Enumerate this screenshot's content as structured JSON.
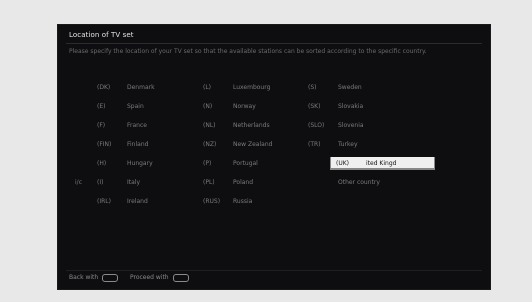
{
  "screen": {
    "title": "Location of TV set",
    "description": "Please specify the location of your TV set so that the available stations can be sorted according to the specific country."
  },
  "countries": [
    {
      "code": "(DK)",
      "name": "Denmark"
    },
    {
      "code": "(E)",
      "name": "Spain"
    },
    {
      "code": "(F)",
      "name": "France"
    },
    {
      "code": "(FIN)",
      "name": "Finland"
    },
    {
      "code": "(H)",
      "name": "Hungary"
    },
    {
      "code": "(I)",
      "name": "Italy"
    },
    {
      "code": "(IRL)",
      "name": "Ireland"
    },
    {
      "code": "(L)",
      "name": "Luxembourg"
    },
    {
      "code": "(N)",
      "name": "Norway"
    },
    {
      "code": "(NL)",
      "name": "Netherlands"
    },
    {
      "code": "(NZ)",
      "name": "New Zealand"
    },
    {
      "code": "(P)",
      "name": "Portugal"
    },
    {
      "code": "(PL)",
      "name": "Poland"
    },
    {
      "code": "(RUS)",
      "name": "Russia"
    },
    {
      "code": "(S)",
      "name": "Sweden"
    },
    {
      "code": "(SK)",
      "name": "Slovakia"
    },
    {
      "code": "(SLO)",
      "name": "Slovenia"
    },
    {
      "code": "(TR)",
      "name": "Turkey"
    },
    {
      "code": "(UK)",
      "name": "ited Kingd"
    },
    {
      "code": "",
      "name": "Other country"
    }
  ],
  "current_marker": "i/c",
  "footer": {
    "back_label": "Back with",
    "proceed_label": "Proceed with"
  }
}
